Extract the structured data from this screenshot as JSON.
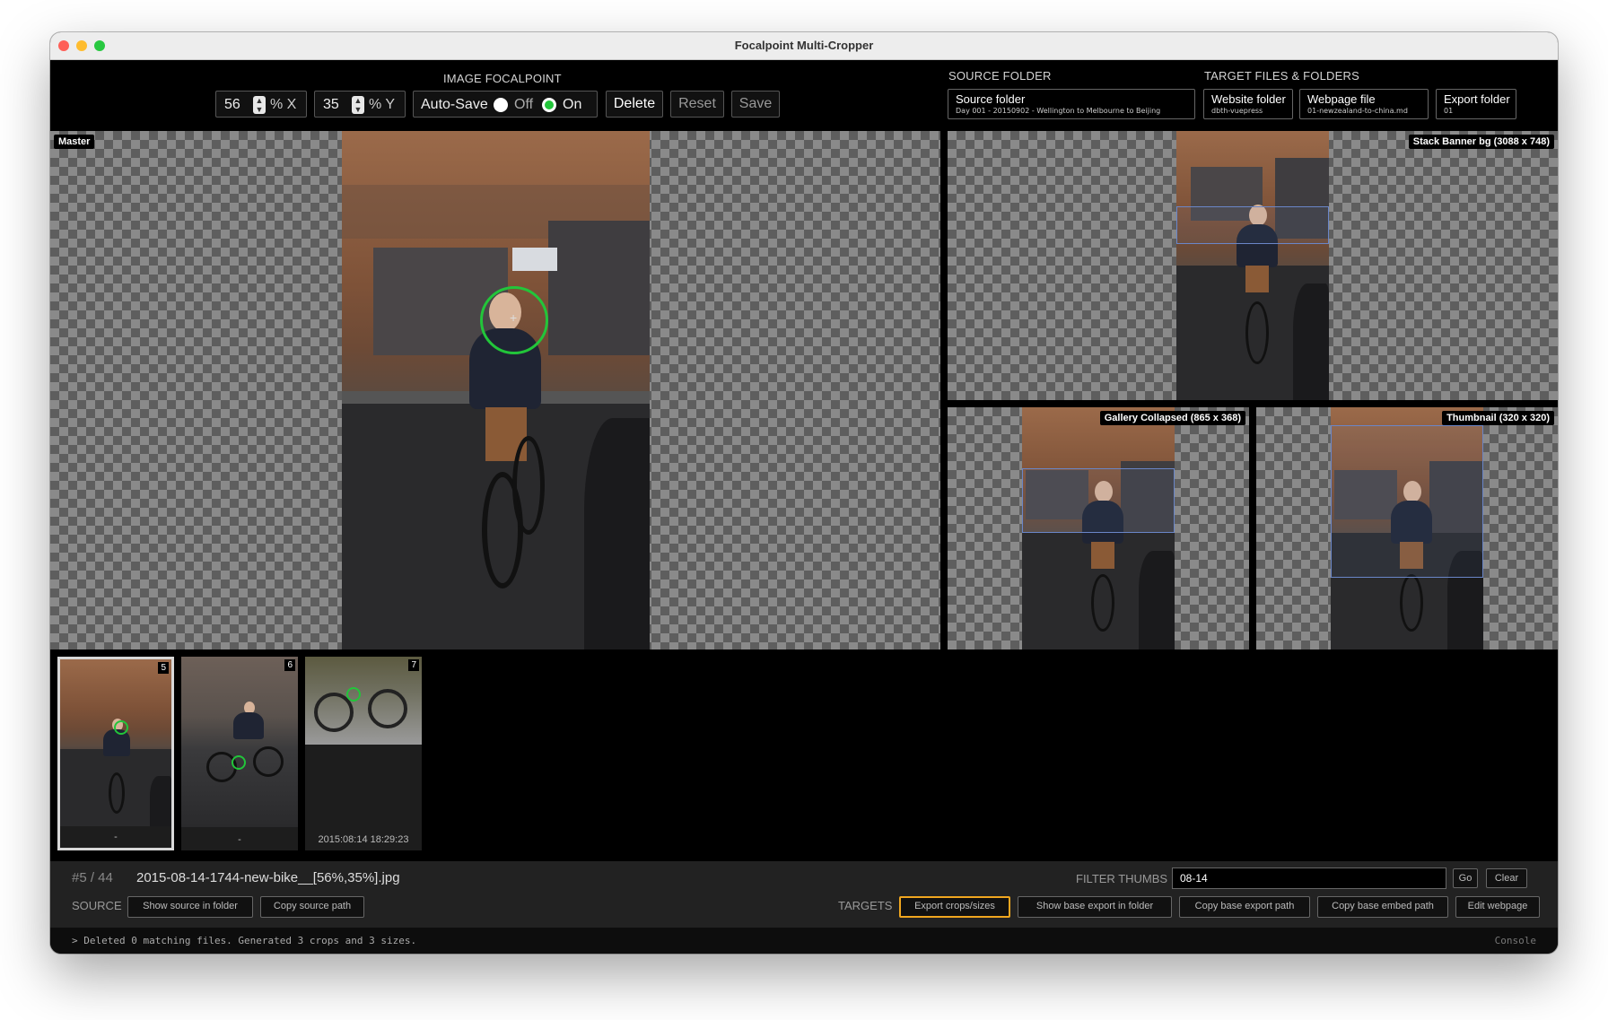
{
  "window": {
    "title": "Focalpoint Multi-Cropper"
  },
  "focalpoint": {
    "heading": "IMAGE FOCALPOINT",
    "x_value": "56",
    "x_unit": "% X",
    "y_value": "35",
    "y_unit": "% Y",
    "autosave_label": "Auto-Save",
    "off_label": "Off",
    "on_label": "On",
    "autosave_state": "On",
    "delete_label": "Delete",
    "reset_label": "Reset",
    "save_label": "Save"
  },
  "source_folder": {
    "heading": "SOURCE FOLDER",
    "title": "Source folder",
    "path": "Day 001 - 20150902 - Wellington to Melbourne to Beijing"
  },
  "targets": {
    "heading": "TARGET FILES & FOLDERS",
    "website_title": "Website folder",
    "website_path": "dbth-vuepress",
    "webpage_title": "Webpage file",
    "webpage_path": "01-newzealand-to-china.md",
    "export_title": "Export folder",
    "export_path": "01"
  },
  "panes": {
    "master": "Master",
    "banner": "Stack Banner bg (3088 x 748)",
    "gallery": "Gallery Collapsed (865 x 368)",
    "thumbnail": "Thumbnail (320 x 320)"
  },
  "thumbs": [
    {
      "number": "5",
      "caption": "-",
      "selected": true
    },
    {
      "number": "6",
      "caption": "-",
      "selected": false
    },
    {
      "number": "7",
      "caption": "2015:08:14 18:29:23",
      "selected": false
    }
  ],
  "info": {
    "index": "#5 / 44",
    "filename": "2015-08-14-1744-new-bike__[56%,35%].jpg",
    "filter_label": "FILTER THUMBS",
    "filter_value": "08-14",
    "go_label": "Go",
    "clear_label": "Clear"
  },
  "source_actions": {
    "label": "SOURCE",
    "show": "Show source in folder",
    "copy": "Copy source path"
  },
  "target_actions": {
    "label": "TARGETS",
    "export": "Export crops/sizes",
    "show_base": "Show base export in folder",
    "copy_base": "Copy base export path",
    "copy_embed": "Copy base embed path",
    "edit": "Edit webpage"
  },
  "console": {
    "message": "> Deleted 0 matching files. Generated 3 crops and 3 sizes.",
    "label": "Console"
  },
  "colors": {
    "focal_ring": "#22c53a",
    "highlight": "#f0a61f",
    "crop_outline": "#6a86c8"
  }
}
